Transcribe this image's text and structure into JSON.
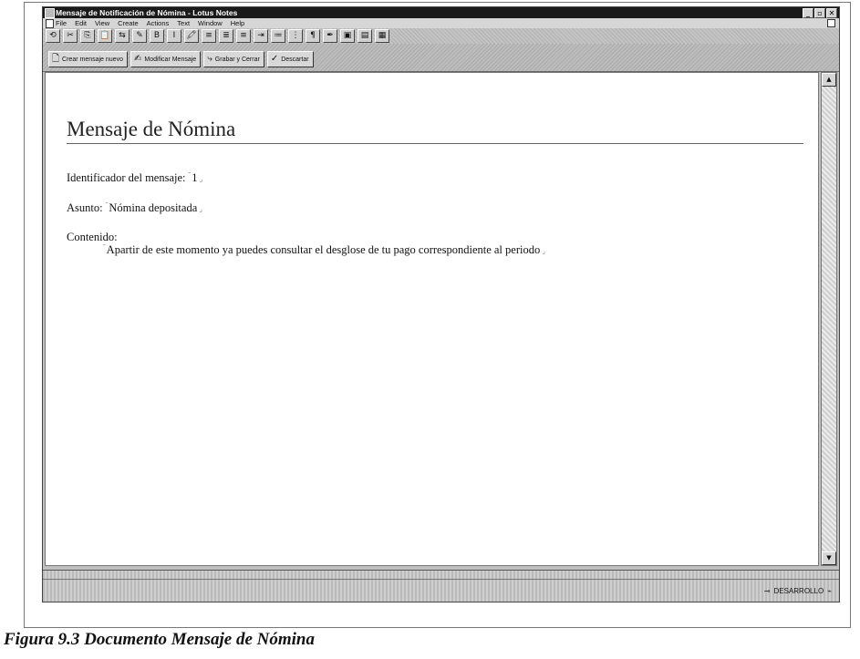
{
  "window": {
    "title": "Mensaje de Notificación de Nómina - Lotus Notes",
    "controls": [
      "_",
      "▫",
      "✕"
    ]
  },
  "menu": [
    "File",
    "Edit",
    "View",
    "Create",
    "Actions",
    "Text",
    "Window",
    "Help"
  ],
  "smarticons": [
    "⟲",
    "✂",
    "⎘",
    "📋",
    "⇆",
    "✎",
    "B",
    "I",
    "🖍",
    "≡",
    "≣",
    "≡",
    "⇥",
    "≔",
    "⋮",
    "¶",
    "✒",
    "▣",
    "▤",
    "▦"
  ],
  "action_bar": {
    "buttons": [
      {
        "label": "Crear mensaje nuevo",
        "icon": "new-document-icon"
      },
      {
        "label": "Modificar Mensaje",
        "icon": "edit-document-icon"
      },
      {
        "label": "Grabar y Cerrar",
        "icon": "save-icon"
      },
      {
        "label": "Descartar",
        "icon": "discard-icon"
      }
    ]
  },
  "document": {
    "title": "Mensaje de Nómina",
    "id_label": "Identificador del mensaje:",
    "id_value": "1",
    "subject_label": "Asunto:",
    "subject_value": "Nómina depositada",
    "content_label": "Contenido:",
    "content_value": "Apartir de este momento ya puedes consultar el desglose de tu pago correspondiente al periodo"
  },
  "status": {
    "server": "DESARROLLO"
  },
  "caption": "Figura 9.3 Documento Mensaje de Nómina"
}
